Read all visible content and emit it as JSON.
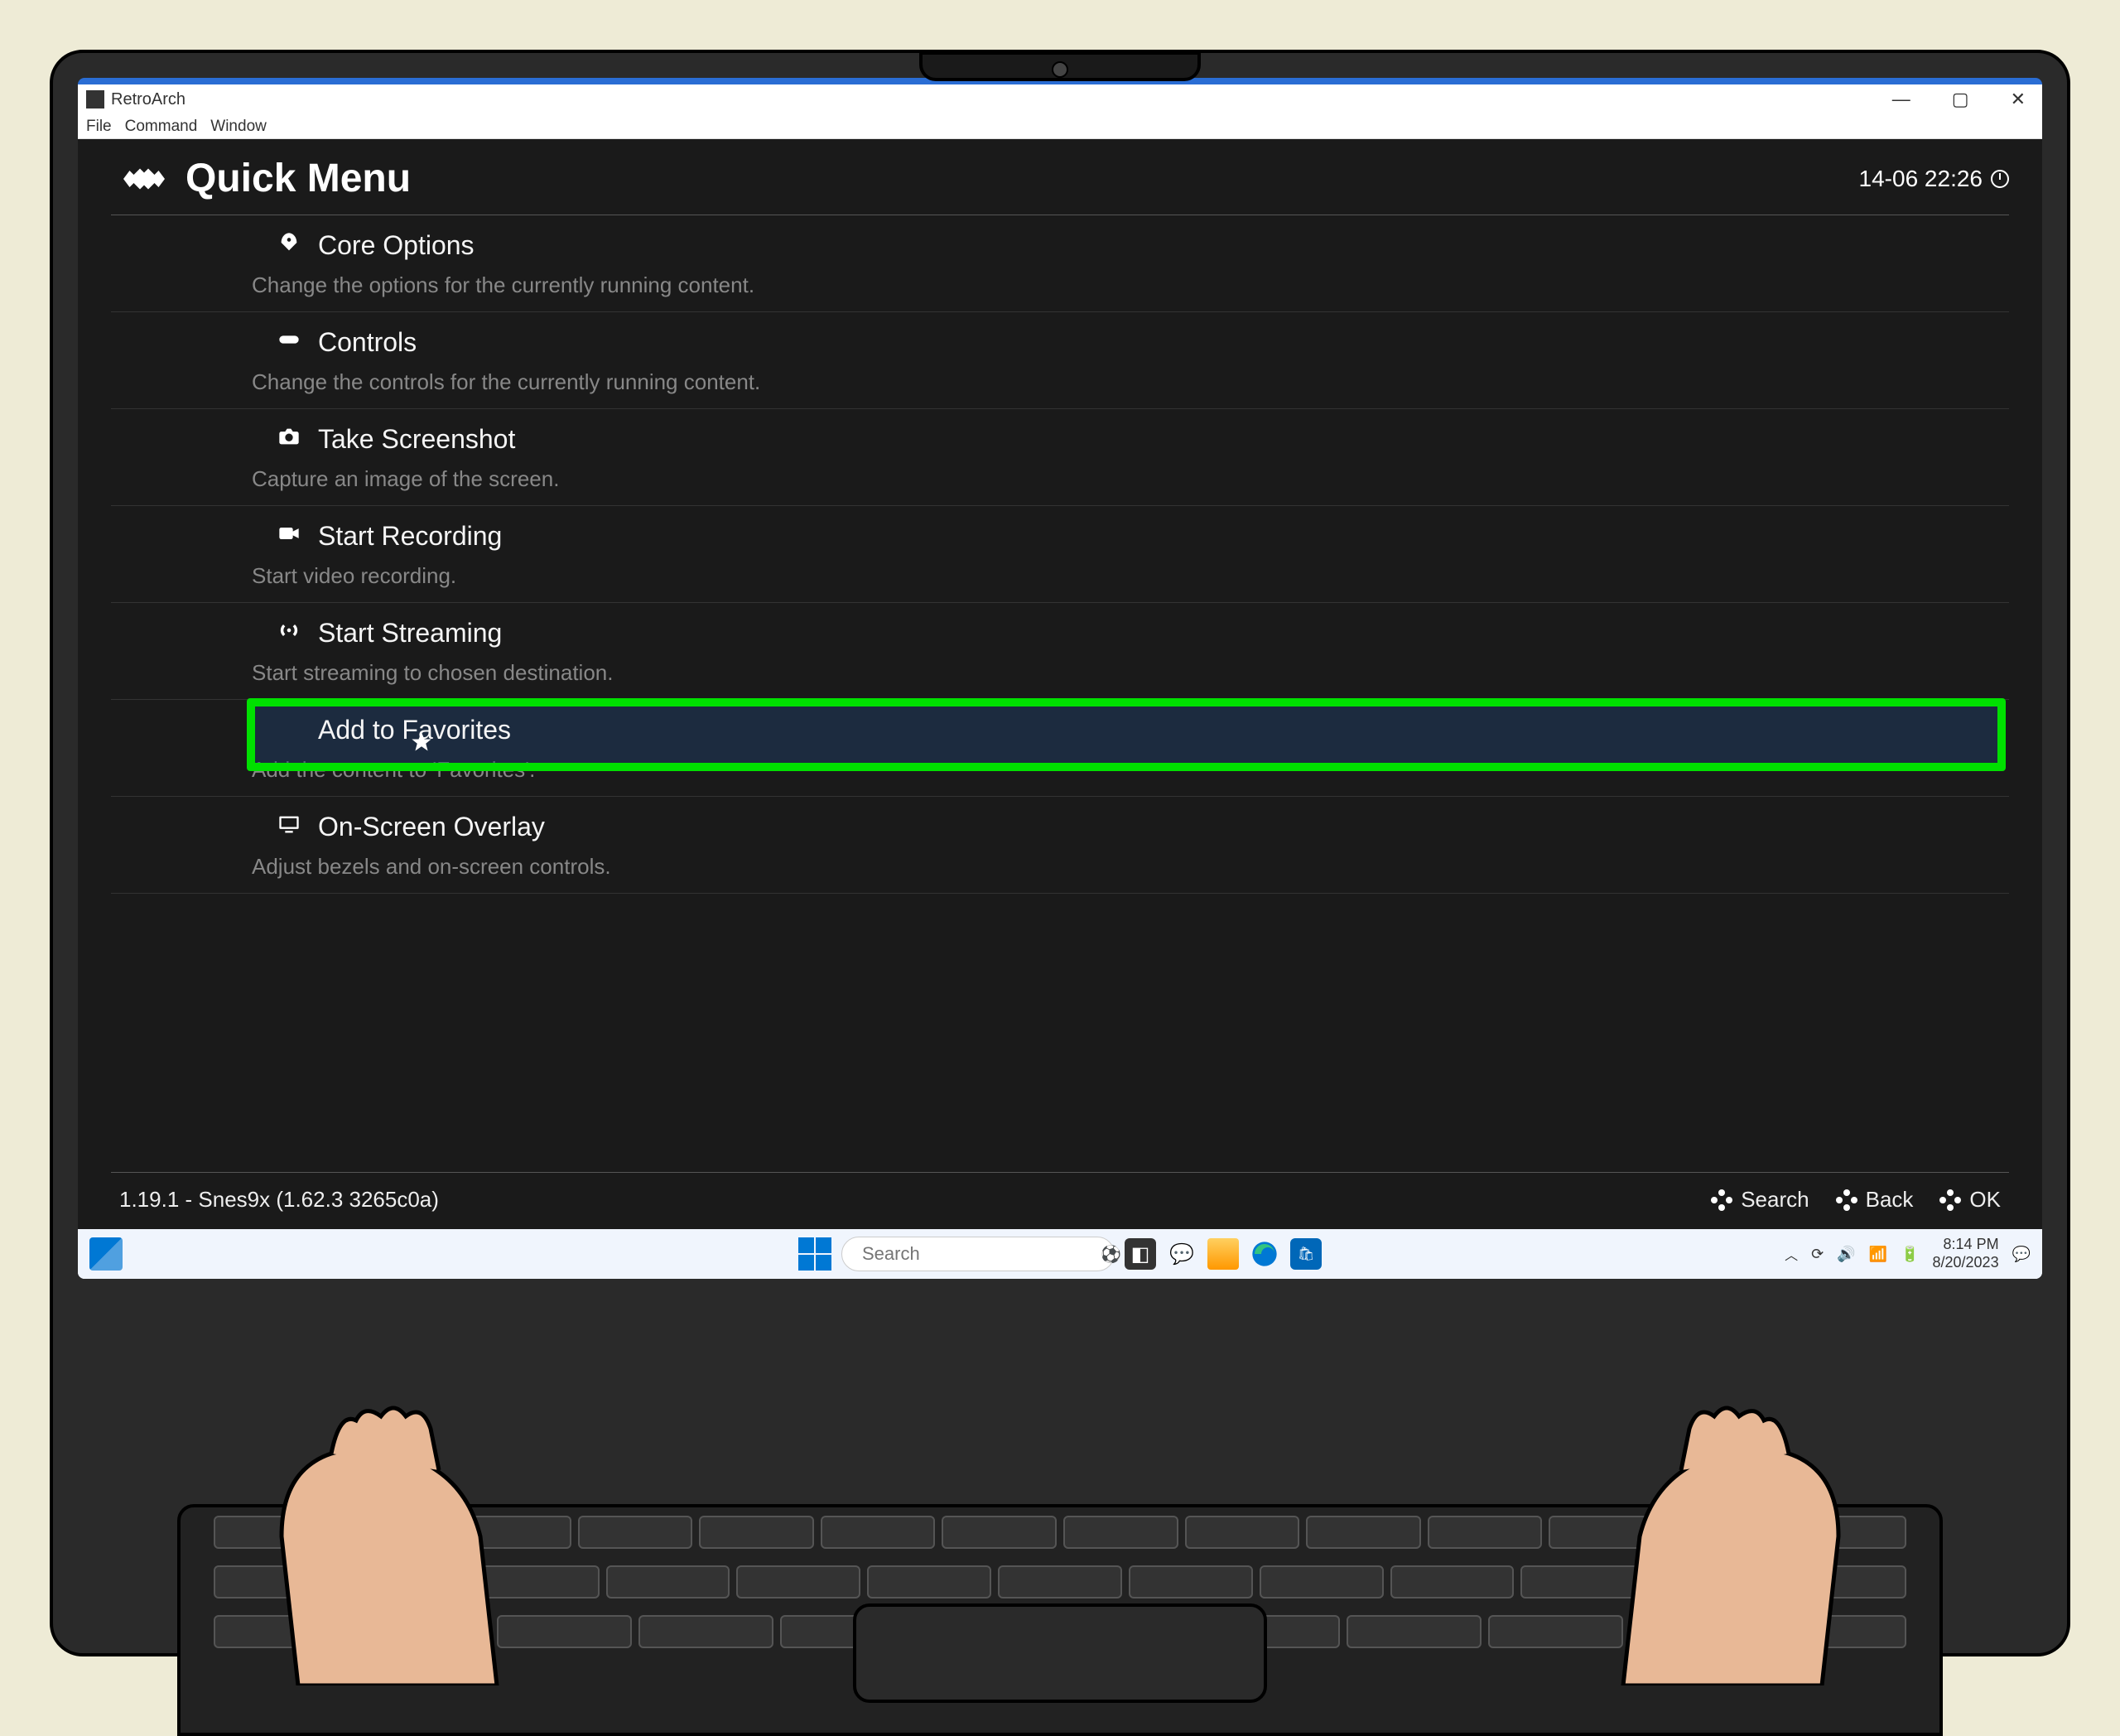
{
  "window": {
    "title": "RetroArch",
    "menubar": [
      "File",
      "Command",
      "Window"
    ]
  },
  "retroarch": {
    "header_title": "Quick Menu",
    "clock": "14-06 22:26",
    "version": "1.19.1 - Snes9x (1.62.3 3265c0a)",
    "footer_buttons": {
      "search": "Search",
      "back": "Back",
      "ok": "OK"
    },
    "items": [
      {
        "icon": "rocket",
        "label": "Core Options",
        "desc": "Change the options for the currently running content."
      },
      {
        "icon": "gamepad",
        "label": "Controls",
        "desc": "Change the controls for the currently running content."
      },
      {
        "icon": "camera",
        "label": "Take Screenshot",
        "desc": "Capture an image of the screen."
      },
      {
        "icon": "videocam",
        "label": "Start Recording",
        "desc": "Start video recording."
      },
      {
        "icon": "broadcast",
        "label": "Start Streaming",
        "desc": "Start streaming to chosen destination."
      },
      {
        "icon": "star",
        "label": "Add to Favorites",
        "desc": "Add the content to 'Favorites'.",
        "highlighted": true
      },
      {
        "icon": "monitor",
        "label": "On-Screen Overlay",
        "desc": "Adjust bezels and on-screen controls."
      }
    ]
  },
  "taskbar": {
    "search_placeholder": "Search",
    "time": "8:14 PM",
    "date": "8/20/2023"
  }
}
